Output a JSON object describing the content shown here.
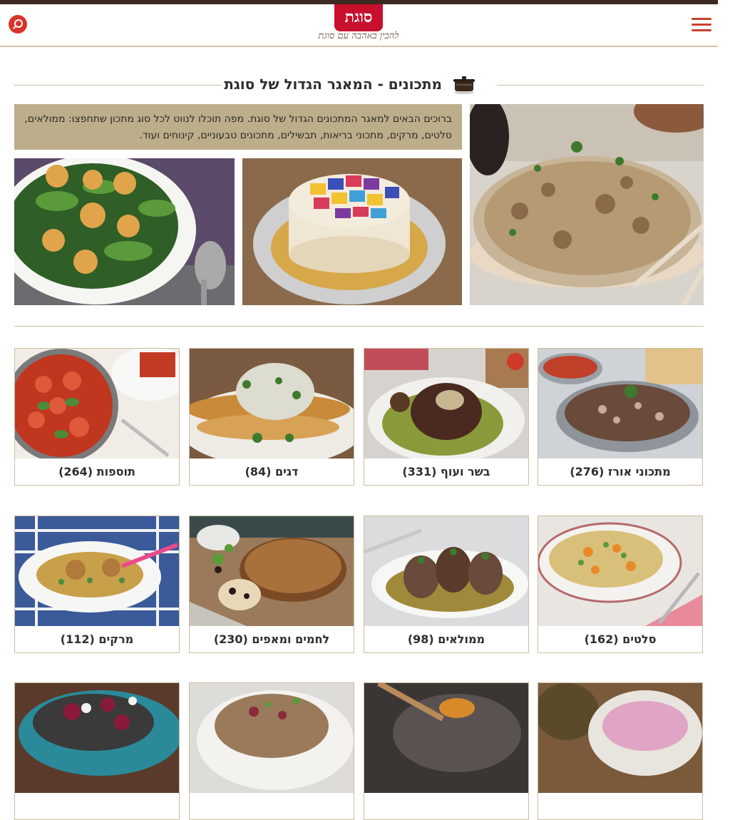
{
  "header": {
    "logo_text": "סוגת",
    "tagline": "להכין באהבה עם סוגת",
    "search_icon": "search-icon",
    "menu_icon": "hamburger-menu-icon"
  },
  "section": {
    "title": "מתכונים - המאגר הגדול של סוגת",
    "intro_text": "ברוכים הבאים למאגר המתכונים הגדול של סוגת. מפה תוכלו לנווט לכל סוג מתכון שתחפצו: ממולאים, סלטים, מרקים, מתכוני בריאות, תבשילים, מתכונים טבעוניים, קינוחים ועוד."
  },
  "categories": [
    {
      "label": "מתכוני אורז (276)"
    },
    {
      "label": "בשר ועוף (331)"
    },
    {
      "label": "דגים (84)"
    },
    {
      "label": "תוספות (264)"
    },
    {
      "label": "סלטים (162)"
    },
    {
      "label": "ממולאים (98)"
    },
    {
      "label": "לחמים ומאפים (230)"
    },
    {
      "label": "מרקים (112)"
    }
  ],
  "colors": {
    "brand_red": "#c8102e",
    "accent_beige": "#bcae8a",
    "border": "#cbbd9f",
    "top_bar": "#3b2a20"
  }
}
